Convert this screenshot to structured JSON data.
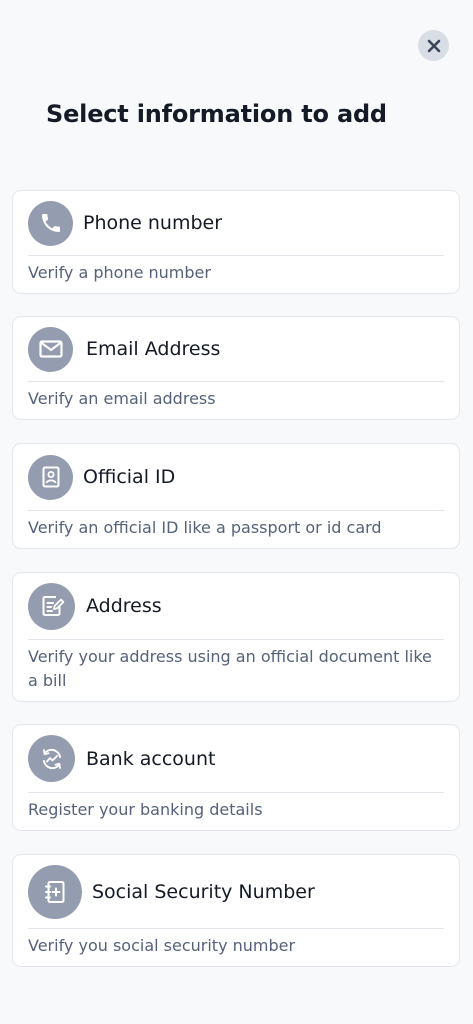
{
  "title": "Select information to add",
  "close": {
    "icon": "close-icon"
  },
  "accent_color": "#949daf",
  "items": [
    {
      "label": "Phone number",
      "description": "Verify a phone number",
      "icon": "phone-icon"
    },
    {
      "label": "Email Address",
      "description": "Verify an email address",
      "icon": "envelope-icon"
    },
    {
      "label": "Official ID",
      "description": "Verify an official ID like a passport or id card",
      "icon": "id-card-icon"
    },
    {
      "label": "Address",
      "description": "Verify your address using an official document like a bill",
      "icon": "document-edit-icon"
    },
    {
      "label": "Bank account",
      "description": "Register your banking details",
      "icon": "bank-sync-icon"
    },
    {
      "label": "Social Security Number",
      "description": "Verify you social security number",
      "icon": "ssn-document-icon"
    }
  ]
}
